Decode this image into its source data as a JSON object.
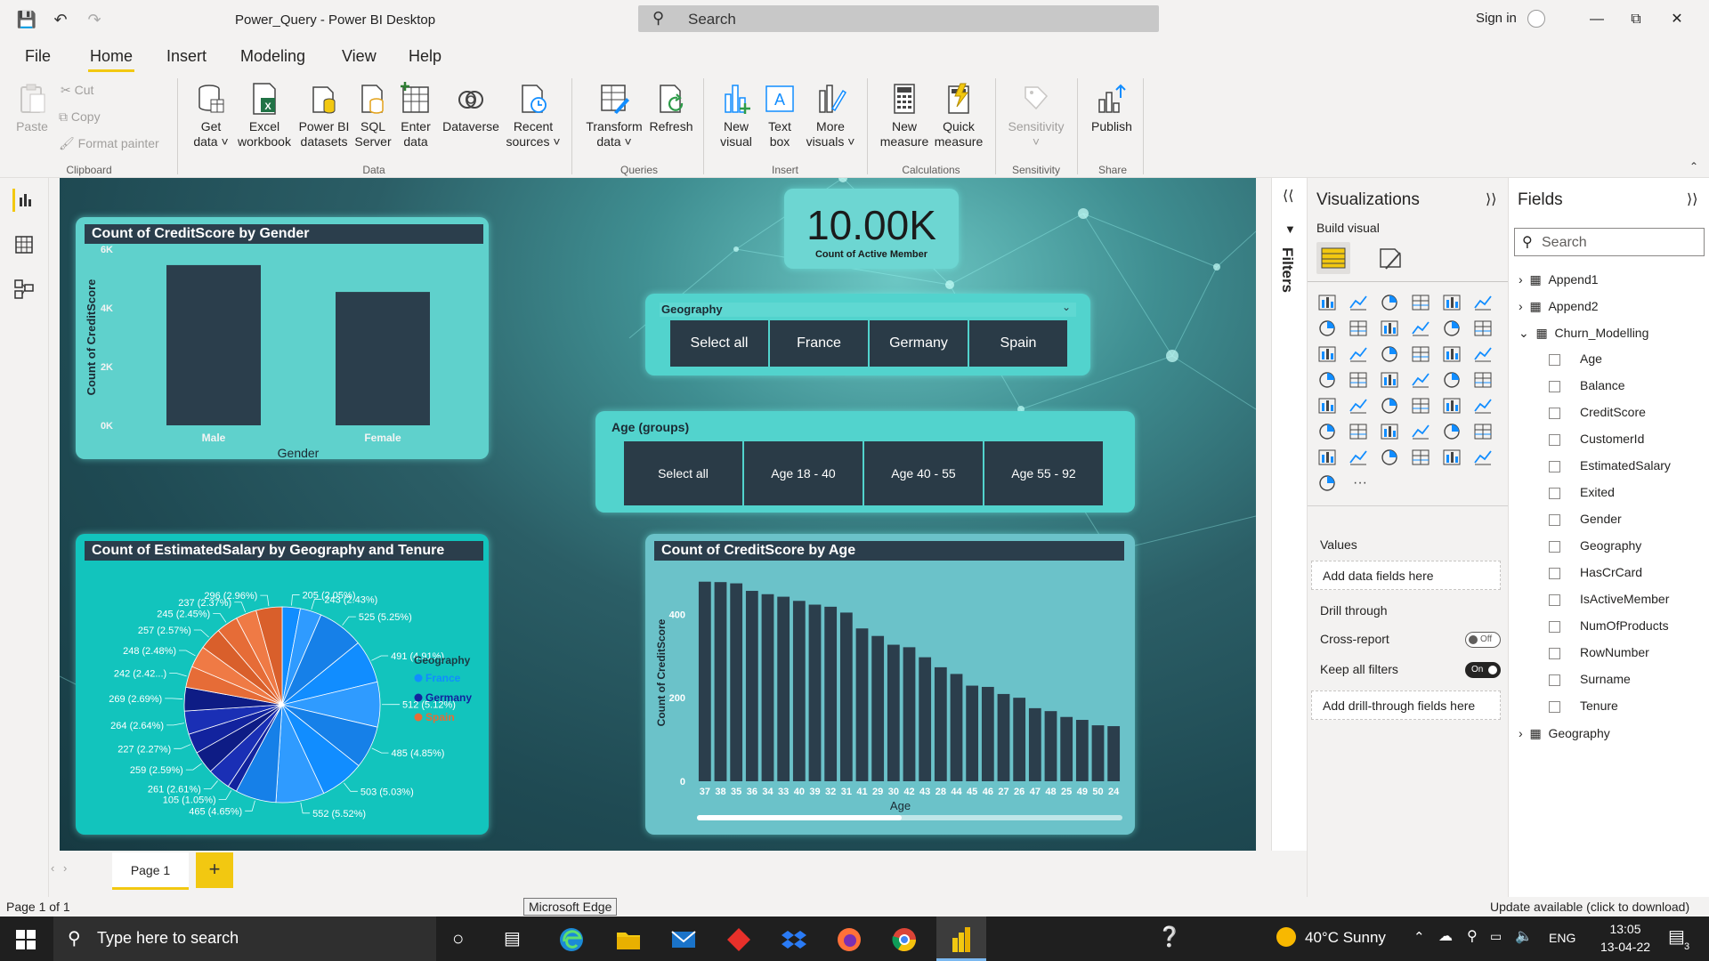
{
  "window": {
    "title": "Power_Query - Power BI Desktop",
    "search_placeholder": "Search",
    "sign_in": "Sign in"
  },
  "menu": [
    "File",
    "Home",
    "Insert",
    "Modeling",
    "View",
    "Help"
  ],
  "ribbon": {
    "clipboard": {
      "paste": "Paste",
      "cut": "Cut",
      "copy": "Copy",
      "format_painter": "Format painter",
      "label": "Clipboard"
    },
    "data": {
      "get_data": "Get data",
      "excel": "Excel workbook",
      "pbi_datasets": "Power BI datasets",
      "sql": "SQL Server",
      "enter_data": "Enter data",
      "dataverse": "Dataverse",
      "recent": "Recent sources",
      "label": "Data"
    },
    "queries": {
      "transform": "Transform data",
      "refresh": "Refresh",
      "label": "Queries"
    },
    "insert": {
      "new_visual": "New visual",
      "text_box": "Text box",
      "more_visuals": "More visuals",
      "label": "Insert"
    },
    "calculations": {
      "new_measure": "New measure",
      "quick_measure": "Quick measure",
      "label": "Calculations"
    },
    "sensitivity": {
      "sensitivity": "Sensitivity",
      "label": "Sensitivity"
    },
    "share": {
      "publish": "Publish",
      "label": "Share"
    }
  },
  "report": {
    "card": {
      "value": "10.00K",
      "label": "Count of Active Member"
    },
    "geo_slicer": {
      "title": "Geography",
      "options": [
        "Select all",
        "France",
        "Germany",
        "Spain"
      ]
    },
    "age_slicer": {
      "title": "Age (groups)",
      "options": [
        "Select all",
        "Age 18 - 40",
        "Age 40 - 55",
        "Age 55 - 92"
      ]
    },
    "pie_legend": {
      "title": "Geography",
      "items": [
        {
          "name": "France",
          "color": "#118dff"
        },
        {
          "name": "Germany",
          "color": "#12239e"
        },
        {
          "name": "Spain",
          "color": "#e66c37"
        }
      ]
    }
  },
  "chart_data": [
    {
      "type": "bar",
      "title": "Count of CreditScore by Gender",
      "xlabel": "Gender",
      "ylabel": "Count of CreditScore",
      "categories": [
        "Male",
        "Female"
      ],
      "values": [
        5457,
        4543
      ],
      "yticks": [
        "0K",
        "2K",
        "4K",
        "6K"
      ],
      "ylim": [
        0,
        6000
      ]
    },
    {
      "type": "pie",
      "title": "Count of EstimatedSalary by Geography and Tenure",
      "legend": "Geography",
      "slices": [
        {
          "label": "205 (2.05%)",
          "value": 205,
          "group": "France"
        },
        {
          "label": "243 (2.43%)",
          "value": 243,
          "group": "France"
        },
        {
          "label": "525 (5.25%)",
          "value": 525,
          "group": "France"
        },
        {
          "label": "491 (4.91%)",
          "value": 491,
          "group": "France"
        },
        {
          "label": "512 (5.12%)",
          "value": 512,
          "group": "France"
        },
        {
          "label": "485 (4.85%)",
          "value": 485,
          "group": "France"
        },
        {
          "label": "503 (5.03%)",
          "value": 503,
          "group": "France"
        },
        {
          "label": "552 (5.52%)",
          "value": 552,
          "group": "France"
        },
        {
          "label": "465 (4.65%)",
          "value": 465,
          "group": "France"
        },
        {
          "label": "105 (1.05%)",
          "value": 105,
          "group": "Germany"
        },
        {
          "label": "261 (2.61%)",
          "value": 261,
          "group": "Germany"
        },
        {
          "label": "259 (2.59%)",
          "value": 259,
          "group": "Germany"
        },
        {
          "label": "227 (2.27%)",
          "value": 227,
          "group": "Germany"
        },
        {
          "label": "264 (2.64%)",
          "value": 264,
          "group": "Germany"
        },
        {
          "label": "269 (2.69%)",
          "value": 269,
          "group": "Germany"
        },
        {
          "label": "242 (2.42...)",
          "value": 242,
          "group": "Spain"
        },
        {
          "label": "248 (2.48%)",
          "value": 248,
          "group": "Spain"
        },
        {
          "label": "257 (2.57%)",
          "value": 257,
          "group": "Spain"
        },
        {
          "label": "245 (2.45%)",
          "value": 245,
          "group": "Spain"
        },
        {
          "label": "237 (2.37%)",
          "value": 237,
          "group": "Spain"
        },
        {
          "label": "296 (2.96%)",
          "value": 296,
          "group": "Spain"
        }
      ]
    },
    {
      "type": "bar",
      "title": "Count of CreditScore by Age",
      "xlabel": "Age",
      "ylabel": "Count of CreditScore",
      "categories": [
        "37",
        "38",
        "35",
        "36",
        "34",
        "33",
        "40",
        "39",
        "32",
        "31",
        "41",
        "29",
        "30",
        "42",
        "43",
        "28",
        "44",
        "45",
        "46",
        "27",
        "26",
        "47",
        "48",
        "25",
        "49",
        "50",
        "24"
      ],
      "values": [
        478,
        477,
        474,
        456,
        448,
        442,
        432,
        423,
        418,
        404,
        366,
        348,
        327,
        321,
        297,
        273,
        257,
        229,
        226,
        209,
        200,
        175,
        168,
        154,
        147,
        134,
        132
      ],
      "yticks": [
        "0",
        "200",
        "400"
      ],
      "ylim": [
        0,
        520
      ]
    }
  ],
  "filters": {
    "label": "Filters"
  },
  "visualizations": {
    "title": "Visualizations",
    "build_visual": "Build visual",
    "values": "Values",
    "add_data_fields": "Add data fields here",
    "drill_through": "Drill through",
    "cross_report": "Cross-report",
    "cross_report_state": "Off",
    "keep_all_filters": "Keep all filters",
    "keep_all_filters_state": "On",
    "add_drill_fields": "Add drill-through fields here"
  },
  "fields": {
    "title": "Fields",
    "search_placeholder": "Search",
    "tables": [
      "Append1",
      "Append2",
      "Churn_Modelling"
    ],
    "churn_columns": [
      "Age",
      "Balance",
      "CreditScore",
      "CustomerId",
      "EstimatedSalary",
      "Exited",
      "Gender",
      "Geography",
      "HasCrCard",
      "IsActiveMember",
      "NumOfProducts",
      "RowNumber",
      "Surname",
      "Tenure"
    ],
    "last_table": "Geography"
  },
  "pages": {
    "tab": "Page 1",
    "add": "+"
  },
  "status": {
    "page": "Page 1 of 1",
    "tooltip": "Microsoft Edge",
    "update": "Update available (click to download)"
  },
  "taskbar": {
    "search": "Type here to search",
    "weather": "40°C  Sunny",
    "lang": "ENG",
    "time": "13:05",
    "date": "13-04-22",
    "notifications": "3"
  }
}
